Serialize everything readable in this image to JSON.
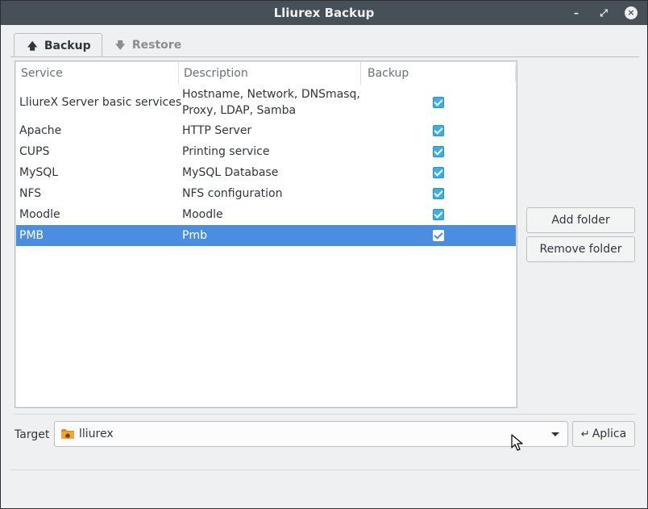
{
  "window": {
    "title": "Lliurex Backup",
    "controls": {
      "minimize": "–",
      "maximize": "⤢",
      "close": "×"
    }
  },
  "tabs": [
    {
      "label": "Backup",
      "icon": "arrow-up-icon",
      "glyph": "🡅",
      "active": true
    },
    {
      "label": "Restore",
      "icon": "arrow-down-icon",
      "glyph": "🡇",
      "active": false
    }
  ],
  "table": {
    "columns": [
      "Service",
      "Description",
      "Backup"
    ],
    "rows": [
      {
        "service": "LliureX Server basic services",
        "description_line1": "Hostname, Network, DNSmasq,",
        "description_line2": "Proxy, LDAP, Samba",
        "backup": true,
        "selected": false
      },
      {
        "service": "Apache",
        "description": "HTTP Server",
        "backup": true,
        "selected": false
      },
      {
        "service": "CUPS",
        "description": "Printing service",
        "backup": true,
        "selected": false
      },
      {
        "service": "MySQL",
        "description": "MySQL Database",
        "backup": true,
        "selected": false
      },
      {
        "service": "NFS",
        "description": "NFS configuration",
        "backup": true,
        "selected": false
      },
      {
        "service": "Moodle",
        "description": "Moodle",
        "backup": true,
        "selected": false
      },
      {
        "service": "PMB",
        "description": "Pmb",
        "backup": true,
        "selected": true
      }
    ]
  },
  "side_buttons": {
    "add_folder": "Add folder",
    "remove_folder": "Remove folder"
  },
  "target": {
    "label": "Target",
    "value": "lliurex",
    "icon": "home-folder-icon"
  },
  "apply": {
    "label": "Aplica",
    "icon": "enter-arrow-icon",
    "glyph": "↵"
  },
  "colors": {
    "titlebar": "#475057",
    "selection": "#4b8ee0",
    "checkbox": "#3daee9",
    "background": "#eff0f1"
  }
}
